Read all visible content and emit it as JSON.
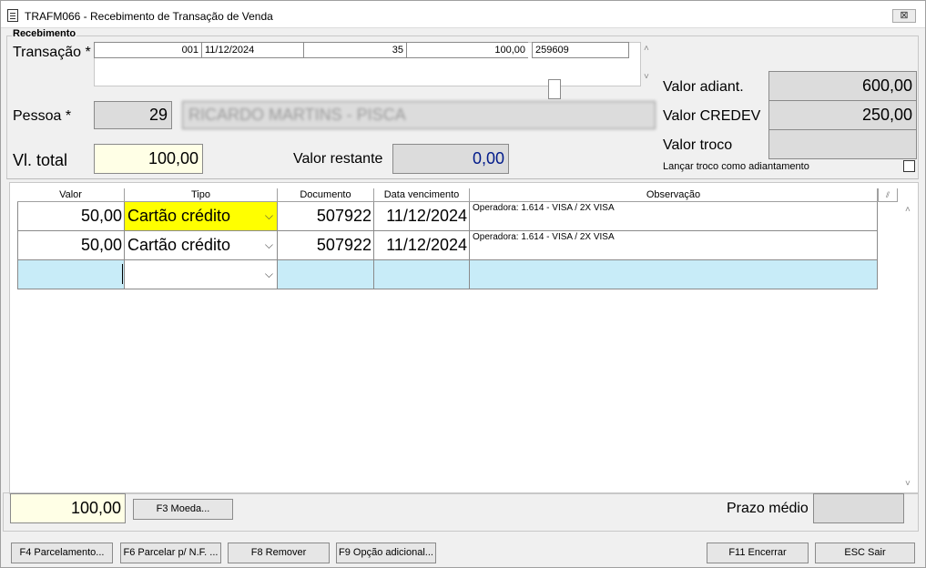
{
  "window": {
    "title": "TRAFM066 - Recebimento de Transação de Venda",
    "close_symbol": "⊠"
  },
  "section": {
    "title": "Recebimento"
  },
  "transacao": {
    "label": "Transação *",
    "codigo": "001",
    "data": "11/12/2024",
    "vazio": "",
    "numero": "35",
    "valor": "100,00",
    "id": "259609"
  },
  "pessoa": {
    "label": "Pessoa *",
    "codigo": "29",
    "nome": "RICARDO MARTINS - PISCA"
  },
  "totals": {
    "vl_total_label": "Vl. total",
    "vl_total": "100,00",
    "valor_restante_label": "Valor restante",
    "valor_restante": "0,00",
    "valor_adiant_label": "Valor adiant.",
    "valor_adiant": "600,00",
    "valor_credev_label": "Valor CREDEV",
    "valor_credev": "250,00",
    "valor_troco_label": "Valor troco",
    "valor_troco": "",
    "lancar_troco_label": "Lançar troco como adiantamento"
  },
  "grid": {
    "columns": [
      "Valor",
      "Tipo",
      "Documento",
      "Data vencimento",
      "Observação"
    ],
    "rows": [
      {
        "valor": "50,00",
        "tipo": "Cartão crédito",
        "documento": "507922",
        "vencimento": "11/12/2024",
        "observacao": "Operadora: 1.614 - VISA / 2X VISA"
      },
      {
        "valor": "50,00",
        "tipo": "Cartão crédito",
        "documento": "507922",
        "vencimento": "11/12/2024",
        "observacao": "Operadora: 1.614 - VISA / 2X VISA"
      }
    ]
  },
  "footer": {
    "soma": "100,00",
    "moeda_btn": "F3 Moeda...",
    "prazo_medio_label": "Prazo médio",
    "prazo_medio": ""
  },
  "actions": {
    "parcelamento": "F4 Parcelamento...",
    "parcelar_nf": "F6 Parcelar p/ N.F. ...",
    "remover": "F8 Remover",
    "opcao_adicional": "F9 Opção adicional...",
    "encerrar": "F11 Encerrar",
    "sair": "ESC Sair"
  }
}
